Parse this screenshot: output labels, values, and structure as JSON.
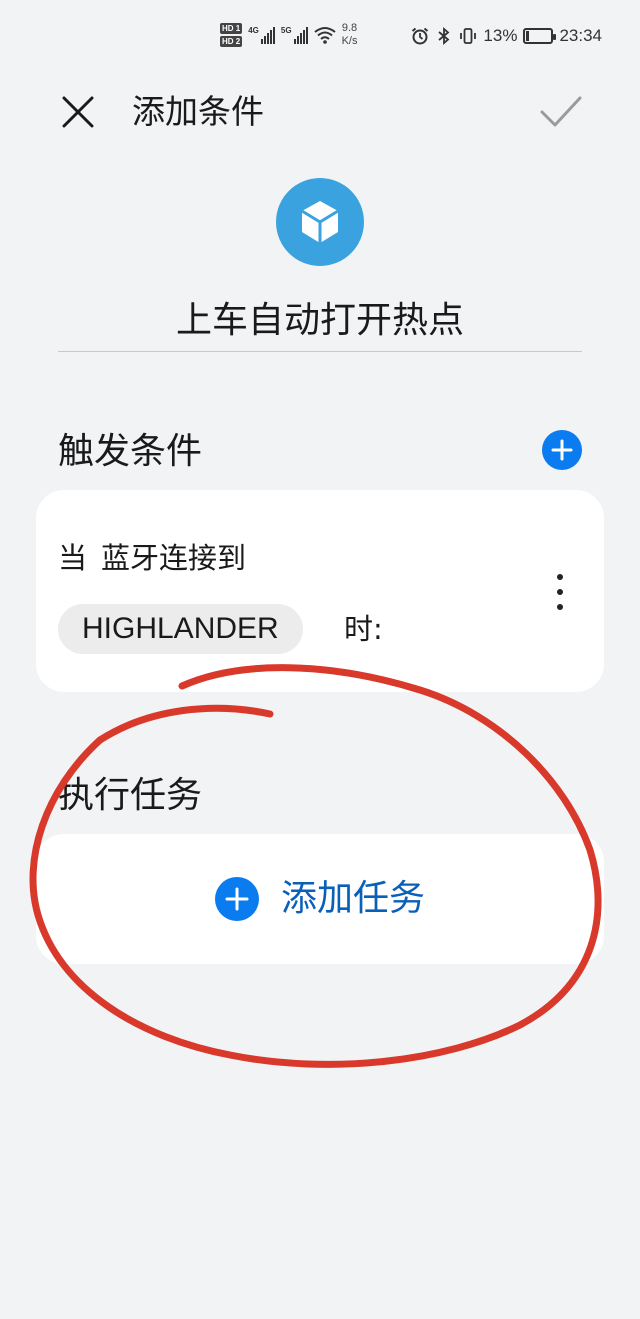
{
  "status_bar": {
    "hd1": "HD 1",
    "hd2": "HD 2",
    "sig1_type": "4G",
    "sig2_type": "5G",
    "net_speed_value": "9.8",
    "net_speed_unit": "K/s",
    "battery": "13%",
    "time": "23:34",
    "battery_level": 0.13
  },
  "header": {
    "title": "添加条件"
  },
  "scene": {
    "name": "上车自动打开热点",
    "icon_color": "#3aa3df"
  },
  "trigger_section": {
    "title": "触发条件",
    "condition": {
      "prefix": "当",
      "event": "蓝牙连接到",
      "device": "HIGHLANDER",
      "suffix": "时:"
    }
  },
  "task_section": {
    "title": "执行任务",
    "add_label": "添加任务"
  },
  "colors": {
    "accent": "#0a7cf0",
    "annotation": "#d8392b",
    "background": "#f1f3f5"
  }
}
